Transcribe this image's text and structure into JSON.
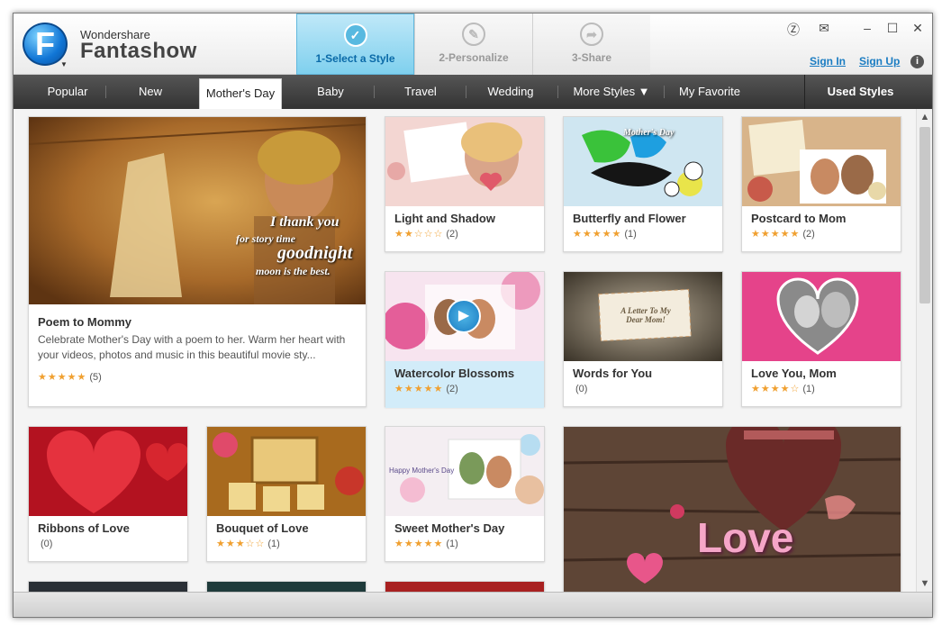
{
  "app": {
    "vendor": "Wondershare",
    "name": "Fantashow",
    "logo_letter": "F"
  },
  "steps": [
    {
      "label": "1-Select a Style",
      "icon": "check-icon",
      "active": true
    },
    {
      "label": "2-Personalize",
      "icon": "pencil-icon",
      "active": false
    },
    {
      "label": "3-Share",
      "icon": "share-icon",
      "active": false
    }
  ],
  "header_links": {
    "sign_in": "Sign In",
    "sign_up": "Sign Up",
    "help": "i"
  },
  "window_controls": [
    "feedback-icon",
    "mail-icon",
    "minimize-icon",
    "maximize-icon",
    "close-icon"
  ],
  "categories": [
    {
      "label": "Popular"
    },
    {
      "label": "New"
    },
    {
      "label": "Mother's Day",
      "selected": true
    },
    {
      "label": "Baby"
    },
    {
      "label": "Travel"
    },
    {
      "label": "Wedding"
    },
    {
      "label": "More Styles ▼"
    },
    {
      "label": "My Favorite"
    }
  ],
  "used_styles_label": "Used Styles",
  "featured": {
    "title": "Poem to Mommy",
    "description": "Celebrate Mother's Day with a poem to her. Warm her heart with your videos, photos and music in this beautiful movie sty...",
    "stars": "★★★★★",
    "count": "(5)",
    "overlay_lines": [
      "I thank you",
      "for story time",
      "goodnight",
      "moon is the best."
    ]
  },
  "styles": [
    {
      "title": "Light and Shadow",
      "stars": "★★☆☆☆",
      "count": "(2)"
    },
    {
      "title": "Butterfly and Flower",
      "stars": "★★★★★",
      "count": "(1)"
    },
    {
      "title": "Postcard to Mom",
      "stars": "★★★★★",
      "count": "(2)"
    },
    {
      "title": "Watercolor Blossoms",
      "stars": "★★★★★",
      "count": "(2)",
      "highlighted": true
    },
    {
      "title": "Words for You",
      "stars": "",
      "count": "(0)"
    },
    {
      "title": "Love You, Mom",
      "stars": "★★★★☆",
      "count": "(1)"
    },
    {
      "title": "Ribbons of Love",
      "stars": "",
      "count": "(0)"
    },
    {
      "title": "Bouquet of Love",
      "stars": "★★★☆☆",
      "count": "(1)"
    },
    {
      "title": "Sweet Mother's Day",
      "stars": "★★★★★",
      "count": "(1)"
    }
  ],
  "big_feature_text": "Love",
  "overlay_texts": {
    "words_for_you": "A Letter To My Dear Mom!",
    "sweet_mothers_day": "Happy Mother's Day",
    "butterfly": "Mother's Day"
  },
  "colors": {
    "accent": "#1a7cc2",
    "nav_bg": "#3a3a3a",
    "star": "#f0a030",
    "highlight": "#d2ecf9"
  }
}
